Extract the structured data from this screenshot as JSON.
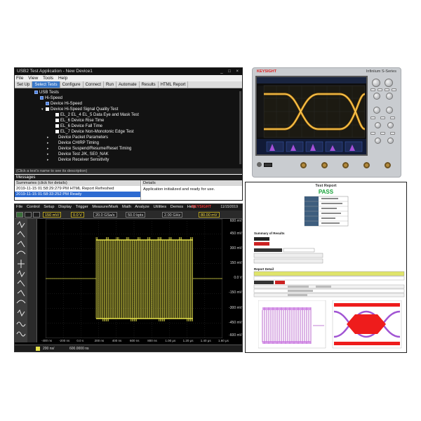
{
  "app": {
    "title": "USB2 Test Application  -  New Device1",
    "window_buttons": "_ □ ×",
    "menu": [
      "File",
      "View",
      "Tools",
      "Help"
    ],
    "tabs": [
      "Set Up",
      "Select Tests",
      "Configure",
      "Connect",
      "Run",
      "Automate",
      "Results",
      "HTML Report"
    ],
    "active_tab": "Select Tests",
    "tree": [
      {
        "label": "USB Tests",
        "arrow": "",
        "box": "fill"
      },
      {
        "label": "Hi-Speed",
        "arrow": "",
        "box": "fill"
      },
      {
        "label": "Device Hi-Speed",
        "arrow": "",
        "box": "fill"
      },
      {
        "label": "Device Hi-Speed Signal Quality Test",
        "arrow": "▾",
        "box": "chk"
      },
      {
        "label": "EL_2  EL_4  EL_5 Data Eye and Mask Test",
        "arrow": "",
        "box": "chk"
      },
      {
        "label": "EL_6 Device Rise Time",
        "arrow": "",
        "box": "chk"
      },
      {
        "label": "EL_6 Device Fall Time",
        "arrow": "",
        "box": "chk"
      },
      {
        "label": "EL_7 Device Non-Monotonic Edge Test",
        "arrow": "",
        "box": "chk"
      },
      {
        "label": "Device Packet Parameters",
        "arrow": "▸",
        "box": "none"
      },
      {
        "label": "Device CHIRP Timing",
        "arrow": "▸",
        "box": "none"
      },
      {
        "label": "Device Suspend/Resume/Reset Timing",
        "arrow": "▸",
        "box": "none"
      },
      {
        "label": "Device Test J/K, SE0_NAK",
        "arrow": "▸",
        "box": "none"
      },
      {
        "label": "Device Receiver Sensitivity",
        "arrow": "▸",
        "box": "none"
      }
    ],
    "tree_footer": "(Click a test's name to see its description)",
    "messages_label": "Messages",
    "summaries_header": "Summaries (click for details)",
    "messages": [
      "2019-11-15 01:58:29:279 PM HTML Report Refreshed",
      "2019-11-15 01:58:33:252 PM Ready"
    ],
    "details_header": "Details",
    "details_text": "Application initialized and ready for use."
  },
  "report": {
    "title": "Test Report",
    "status": "PASS",
    "status_color": "#1aa33a",
    "summary_label": "Summary of Results",
    "details_label": "Report Detail"
  },
  "scope_front": {
    "brand": "KEYSIGHT",
    "model": "Infiniium  S-Series"
  },
  "osc": {
    "menu": [
      "File",
      "Control",
      "Setup",
      "Display",
      "Trigger",
      "Measure/Mark",
      "Math",
      "Analyze",
      "Utilities",
      "Demos",
      "Help"
    ],
    "logo": "KEYSIGHT",
    "date": "11/15/2019",
    "toolbar": {
      "ch_scale": "150 mV/",
      "ch_offset": "0.0 V",
      "sample_rate": "20.0 GSa/s",
      "memory": "50.0 kpts",
      "bandwidth": "2.00 GHz",
      "trigger_level": "80.00 mV"
    },
    "right_labels": [
      "600 mV",
      "450 mV",
      "300 mV",
      "150 mV",
      "0.0 V",
      "-150 mV",
      "-300 mV",
      "-450 mV",
      "-600 mV"
    ],
    "x_labels": [
      "-400 ns",
      "-200 ns",
      "0.0 s",
      "200 ns",
      "400 ns",
      "600 ns",
      "800 ns",
      "1.00 μs",
      "1.20 μs",
      "1.40 μs",
      "1.60 μs"
    ],
    "status_scale": "200 ns/",
    "status_pos": "600.0000 ns"
  }
}
